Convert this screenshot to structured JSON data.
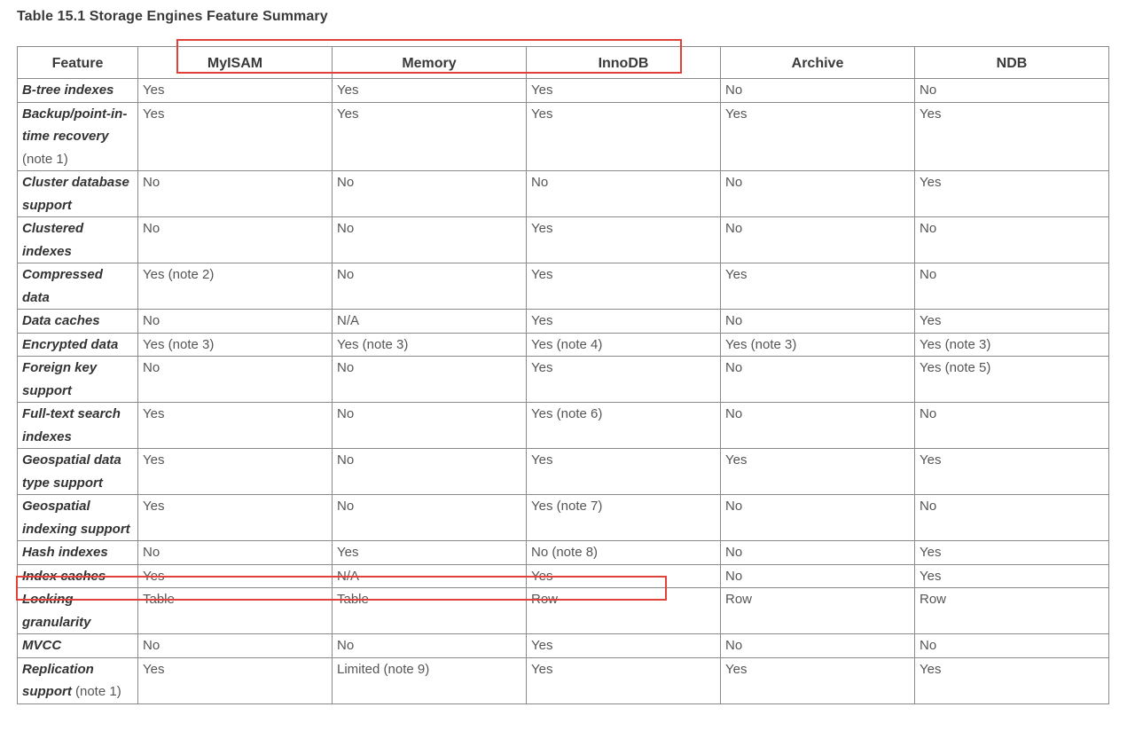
{
  "caption": "Table 15.1 Storage Engines Feature Summary",
  "header": {
    "feature": "Feature",
    "engines": [
      "MyISAM",
      "Memory",
      "InnoDB",
      "Archive",
      "NDB"
    ]
  },
  "rows": [
    {
      "feature": "B-tree indexes",
      "note": "",
      "values": [
        "Yes",
        "Yes",
        "Yes",
        "No",
        "No"
      ]
    },
    {
      "feature": "Backup/point-in-time recovery",
      "note": "(note 1)",
      "values": [
        "Yes",
        "Yes",
        "Yes",
        "Yes",
        "Yes"
      ]
    },
    {
      "feature": "Cluster database support",
      "note": "",
      "values": [
        "No",
        "No",
        "No",
        "No",
        "Yes"
      ]
    },
    {
      "feature": "Clustered indexes",
      "note": "",
      "values": [
        "No",
        "No",
        "Yes",
        "No",
        "No"
      ]
    },
    {
      "feature": "Compressed data",
      "note": "",
      "values": [
        "Yes (note 2)",
        "No",
        "Yes",
        "Yes",
        "No"
      ]
    },
    {
      "feature": "Data caches",
      "note": "",
      "values": [
        "No",
        "N/A",
        "Yes",
        "No",
        "Yes"
      ]
    },
    {
      "feature": "Encrypted data",
      "note": "",
      "values": [
        "Yes (note 3)",
        "Yes (note 3)",
        "Yes (note 4)",
        "Yes (note 3)",
        "Yes (note 3)"
      ]
    },
    {
      "feature": "Foreign key support",
      "note": "",
      "values": [
        "No",
        "No",
        "Yes",
        "No",
        "Yes (note 5)"
      ]
    },
    {
      "feature": "Full-text search indexes",
      "note": "",
      "values": [
        "Yes",
        "No",
        "Yes (note 6)",
        "No",
        "No"
      ]
    },
    {
      "feature": "Geospatial data type support",
      "note": "",
      "values": [
        "Yes",
        "No",
        "Yes",
        "Yes",
        "Yes"
      ]
    },
    {
      "feature": "Geospatial indexing support",
      "note": "",
      "values": [
        "Yes",
        "No",
        "Yes (note 7)",
        "No",
        "No"
      ]
    },
    {
      "feature": "Hash indexes",
      "note": "",
      "values": [
        "No",
        "Yes",
        "No (note 8)",
        "No",
        "Yes"
      ]
    },
    {
      "feature": "Index caches",
      "note": "",
      "values": [
        "Yes",
        "N/A",
        "Yes",
        "No",
        "Yes"
      ]
    },
    {
      "feature": "Locking granularity",
      "note": "",
      "values": [
        "Table",
        "Table",
        "Row",
        "Row",
        "Row"
      ]
    },
    {
      "feature": "MVCC",
      "note": "",
      "values": [
        "No",
        "No",
        "Yes",
        "No",
        "No"
      ]
    },
    {
      "feature": "Replication support",
      "note": "(note 1)",
      "values": [
        "Yes",
        "Limited (note 9)",
        "Yes",
        "Yes",
        "Yes"
      ]
    }
  ],
  "highlights": {
    "color": "#e0423a"
  }
}
